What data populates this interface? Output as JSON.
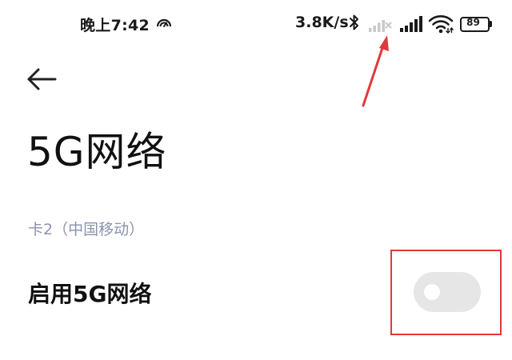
{
  "status_bar": {
    "time": "晚上7:42",
    "alarm_icon": "alarm-icon",
    "network_speed": "3.8K/s",
    "bluetooth_icon": "bluetooth-icon",
    "sim2_icon": "signal-no-service-icon",
    "sim1_icon": "signal-full-icon",
    "wifi_icon": "wifi-icon",
    "battery_level": "89"
  },
  "header": {
    "back_icon": "back-arrow-icon",
    "title": "5G网络"
  },
  "section": {
    "label": "卡2（中国移动）"
  },
  "settings": {
    "enable_5g": {
      "label": "启用5G网络",
      "enabled": false
    }
  },
  "annotations": {
    "arrow_color": "#e03a3a",
    "highlight_color": "#e03a3a"
  },
  "colors": {
    "section_label": "#8b93ad",
    "toggle_off_track": "#e6e6e6",
    "toggle_knob": "#ffffff"
  }
}
